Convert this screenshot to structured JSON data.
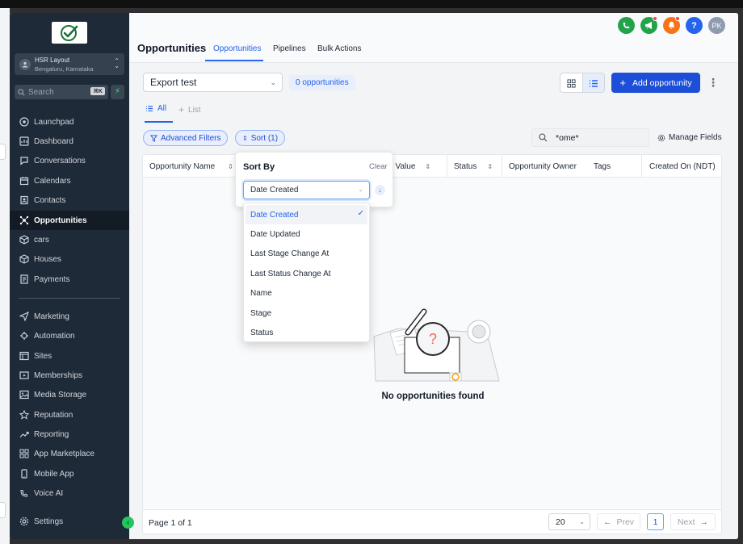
{
  "sidebar": {
    "location": {
      "name": "HSR Layout",
      "city": "Bengaluru, Karnataka"
    },
    "search": {
      "placeholder": "Search",
      "shortcut": "⌘K"
    },
    "items": [
      {
        "label": "Launchpad",
        "icon": "launchpad-icon"
      },
      {
        "label": "Dashboard",
        "icon": "dashboard-icon"
      },
      {
        "label": "Conversations",
        "icon": "chat-icon"
      },
      {
        "label": "Calendars",
        "icon": "calendar-icon"
      },
      {
        "label": "Contacts",
        "icon": "contacts-icon"
      },
      {
        "label": "Opportunities",
        "icon": "opportunities-icon",
        "active": true
      },
      {
        "label": "cars",
        "icon": "box-icon"
      },
      {
        "label": "Houses",
        "icon": "box-icon"
      },
      {
        "label": "Payments",
        "icon": "payments-icon"
      }
    ],
    "items2": [
      {
        "label": "Marketing",
        "icon": "send-icon"
      },
      {
        "label": "Automation",
        "icon": "automation-icon"
      },
      {
        "label": "Sites",
        "icon": "sites-icon"
      },
      {
        "label": "Memberships",
        "icon": "memberships-icon"
      },
      {
        "label": "Media Storage",
        "icon": "media-icon"
      },
      {
        "label": "Reputation",
        "icon": "star-icon"
      },
      {
        "label": "Reporting",
        "icon": "reporting-icon"
      },
      {
        "label": "App Marketplace",
        "icon": "grid-icon"
      },
      {
        "label": "Mobile App",
        "icon": "mobile-icon"
      },
      {
        "label": "Voice AI",
        "icon": "voice-icon"
      }
    ],
    "settings": "Settings"
  },
  "header": {
    "title": "Opportunities",
    "tabs": [
      "Opportunities",
      "Pipelines",
      "Bulk Actions"
    ],
    "avatar": "PK",
    "help": "?"
  },
  "toolbar": {
    "pipeline": "Export test",
    "count": "0 opportunities",
    "add_label": "Add opportunity"
  },
  "views": {
    "all": "All",
    "list": "List"
  },
  "filters": {
    "advanced": "Advanced Filters",
    "sort": "Sort (1)",
    "search_value": "*ome*",
    "manage_fields": "Manage Fields"
  },
  "table": {
    "columns": [
      "Opportunity Name",
      "ty Value",
      "Status",
      "Opportunity Owner",
      "Tags",
      "Created On (NDT)"
    ],
    "empty": "No opportunities found"
  },
  "sort_popover": {
    "title": "Sort By",
    "clear": "Clear",
    "selected": "Date Created",
    "options": [
      "Date Created",
      "Date Updated",
      "Last Stage Change At",
      "Last Status Change At",
      "Name",
      "Stage",
      "Status"
    ]
  },
  "pagination": {
    "page_text": "Page 1 of 1",
    "per_page": "20",
    "prev": "Prev",
    "current": "1",
    "next": "Next"
  },
  "colors": {
    "sidebar_bg": "#1f2a38",
    "accent": "#1d4ed8",
    "call_green": "#22a34a",
    "notify_orange": "#f97316",
    "help_blue": "#2563eb"
  }
}
